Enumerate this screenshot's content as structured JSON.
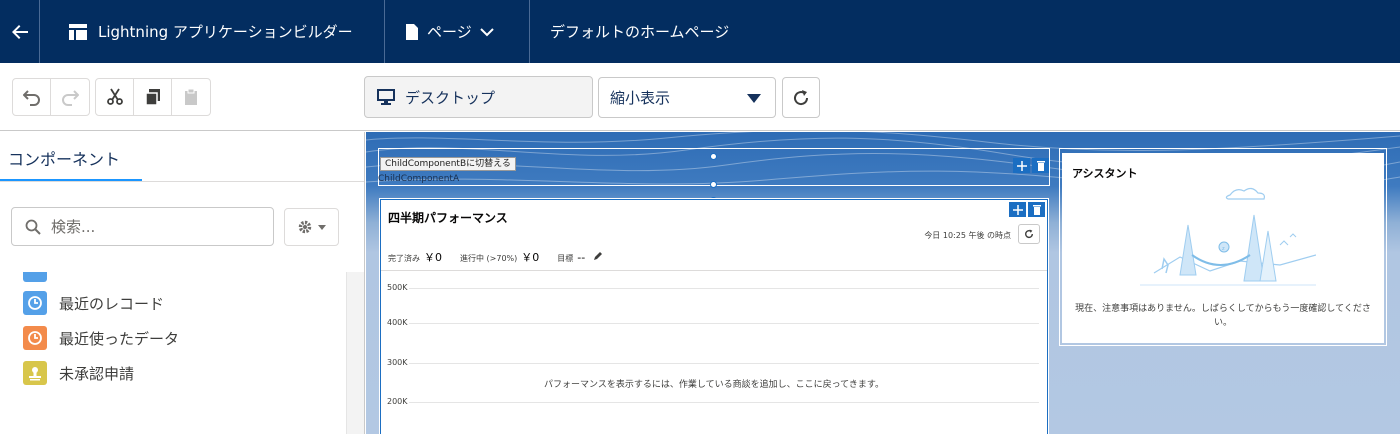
{
  "header": {
    "app_title": "Lightning アプリケーションビルダー",
    "page_menu_label": "ページ",
    "page_name": "デフォルトのホームページ"
  },
  "toolbar": {
    "device_label": "デスクトップ",
    "zoom_value": "縮小表示"
  },
  "left_panel": {
    "tab_label": "コンポーネント",
    "search_placeholder": "検索...",
    "items": [
      {
        "label": "最近のレコード",
        "icon": "clock-icon",
        "color": "#54a0e8"
      },
      {
        "label": "最近使ったデータ",
        "icon": "clock-icon",
        "color": "#f38b4b"
      },
      {
        "label": "未承認申請",
        "icon": "stamp-icon",
        "color": "#d8c64b"
      }
    ]
  },
  "canvas": {
    "header_region": {
      "switch_button_label": "ChildComponentBに切替える",
      "child_label": "ChildComponentA"
    },
    "performance_card": {
      "title": "四半期パフォーマンス",
      "as_of": "今日 10:25 午後 の時点",
      "closed_label": "完了済み",
      "closed_value": "￥0",
      "open_label": "進行中 (>70%)",
      "open_value": "￥0",
      "goal_label": "目標",
      "goal_value": "--",
      "y_ticks": [
        "500K",
        "400K",
        "300K",
        "200K"
      ],
      "empty_message": "パフォーマンスを表示するには、作業している商談を追加し、ここに戻ってきます。"
    },
    "assistant_card": {
      "title": "アシスタント",
      "empty_message": "現在、注意事項はありません。しばらくしてからもう一度確認してください。"
    }
  },
  "colors": {
    "header_bg": "#032d60",
    "accent": "#1b96ff",
    "selection": "#1b6ec2"
  }
}
